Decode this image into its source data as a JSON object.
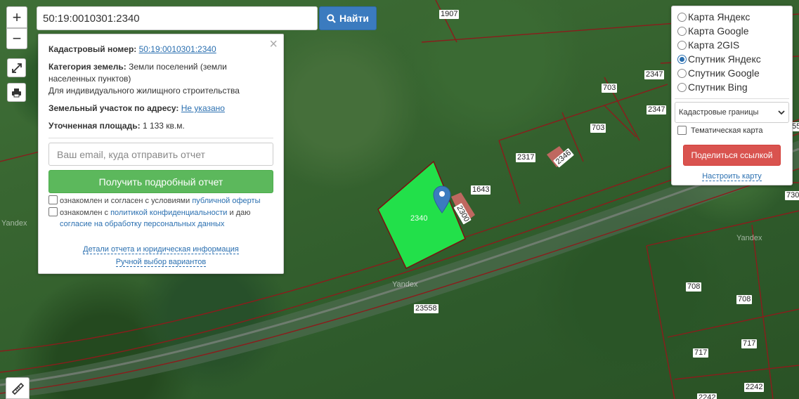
{
  "search": {
    "value": "50:19:0010301:2340",
    "button_label": "Найти"
  },
  "zoom": {
    "in_label": "+",
    "out_label": "−"
  },
  "info": {
    "cadastral_label": "Кадастровый номер:",
    "cadastral_value": "50:19:0010301:2340",
    "land_category_label": "Категория земель:",
    "land_category_value": "Земли поселений (земли",
    "land_category_value_2": "населенных пунктов)",
    "land_use": "Для индивидуального жилищного строительства",
    "address_label": "Земельный участок по адресу:",
    "address_value": "Не указано",
    "area_label": "Уточненная площадь:",
    "area_value": "1 133 кв.м.",
    "email_placeholder": "Ваш email, куда отправить отчет",
    "report_button": "Получить подробный отчет",
    "agree1_text": "ознакомлен и согласен с условиями ",
    "agree1_link": "публичной оферты",
    "agree2_text": "ознакомлен с ",
    "agree2_link": "политикой конфиденциальности",
    "agree2_text2": " и даю",
    "agree2_link2": "согласие на обработку персональных данных",
    "details_link": "Детали отчета и юридическая информация",
    "manual_link": "Ручной выбор вариантов"
  },
  "layers": {
    "options": [
      {
        "label": "Карта Яндекс",
        "checked": false
      },
      {
        "label": "Карта Google",
        "checked": false
      },
      {
        "label": "Карта 2GIS",
        "checked": false
      },
      {
        "label": "Спутник Яндекс",
        "checked": true
      },
      {
        "label": "Спутник Google",
        "checked": false
      },
      {
        "label": "Спутник Bing",
        "checked": false
      }
    ],
    "select_value": "Кадастровые границы",
    "thematic_label": "Тематическая карта",
    "share_button": "Поделиться ссылкой",
    "configure_link": "Настроить карту"
  },
  "map": {
    "parcel_labels": [
      "1907",
      "2347",
      "703",
      "2347",
      "703",
      "2317",
      "2346",
      "1643",
      "2340",
      "2300",
      "23558",
      "708",
      "708",
      "717",
      "717",
      "2242",
      "2242",
      "730",
      "55"
    ],
    "watermarks": [
      "Yandex",
      "Yandex",
      "Yandex"
    ],
    "selected_parcel_color": "#22e04a"
  }
}
